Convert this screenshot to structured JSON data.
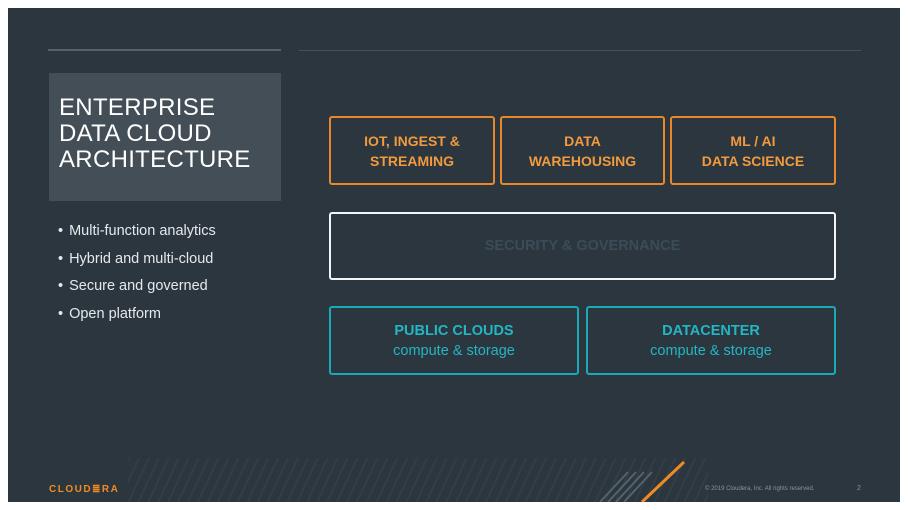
{
  "title": {
    "lines": [
      "ENTERPRISE",
      "DATA CLOUD",
      "ARCHITECTURE"
    ]
  },
  "bullets": [
    "Multi-function analytics",
    "Hybrid and multi-cloud",
    "Secure and governed",
    "Open platform"
  ],
  "diagram": {
    "top_row": [
      {
        "line1": "IOT, INGEST &",
        "line2": "STREAMING"
      },
      {
        "line1": "DATA",
        "line2": "WAREHOUSING"
      },
      {
        "line1": "ML / AI",
        "line2": "DATA SCIENCE"
      }
    ],
    "middle": {
      "label": "SECURITY & GOVERNANCE"
    },
    "bottom_row": [
      {
        "line1": "PUBLIC CLOUDS",
        "line2": "compute & storage"
      },
      {
        "line1": "DATACENTER",
        "line2": "compute & storage"
      }
    ]
  },
  "footer": {
    "logo": "CLOUD≣RA",
    "copyright": "© 2019 Cloudera, Inc. All rights reserved.",
    "page_number": "2"
  },
  "colors": {
    "background": "#2c363e",
    "accent_orange": "#e8882b",
    "accent_teal": "#1aa9b8"
  }
}
